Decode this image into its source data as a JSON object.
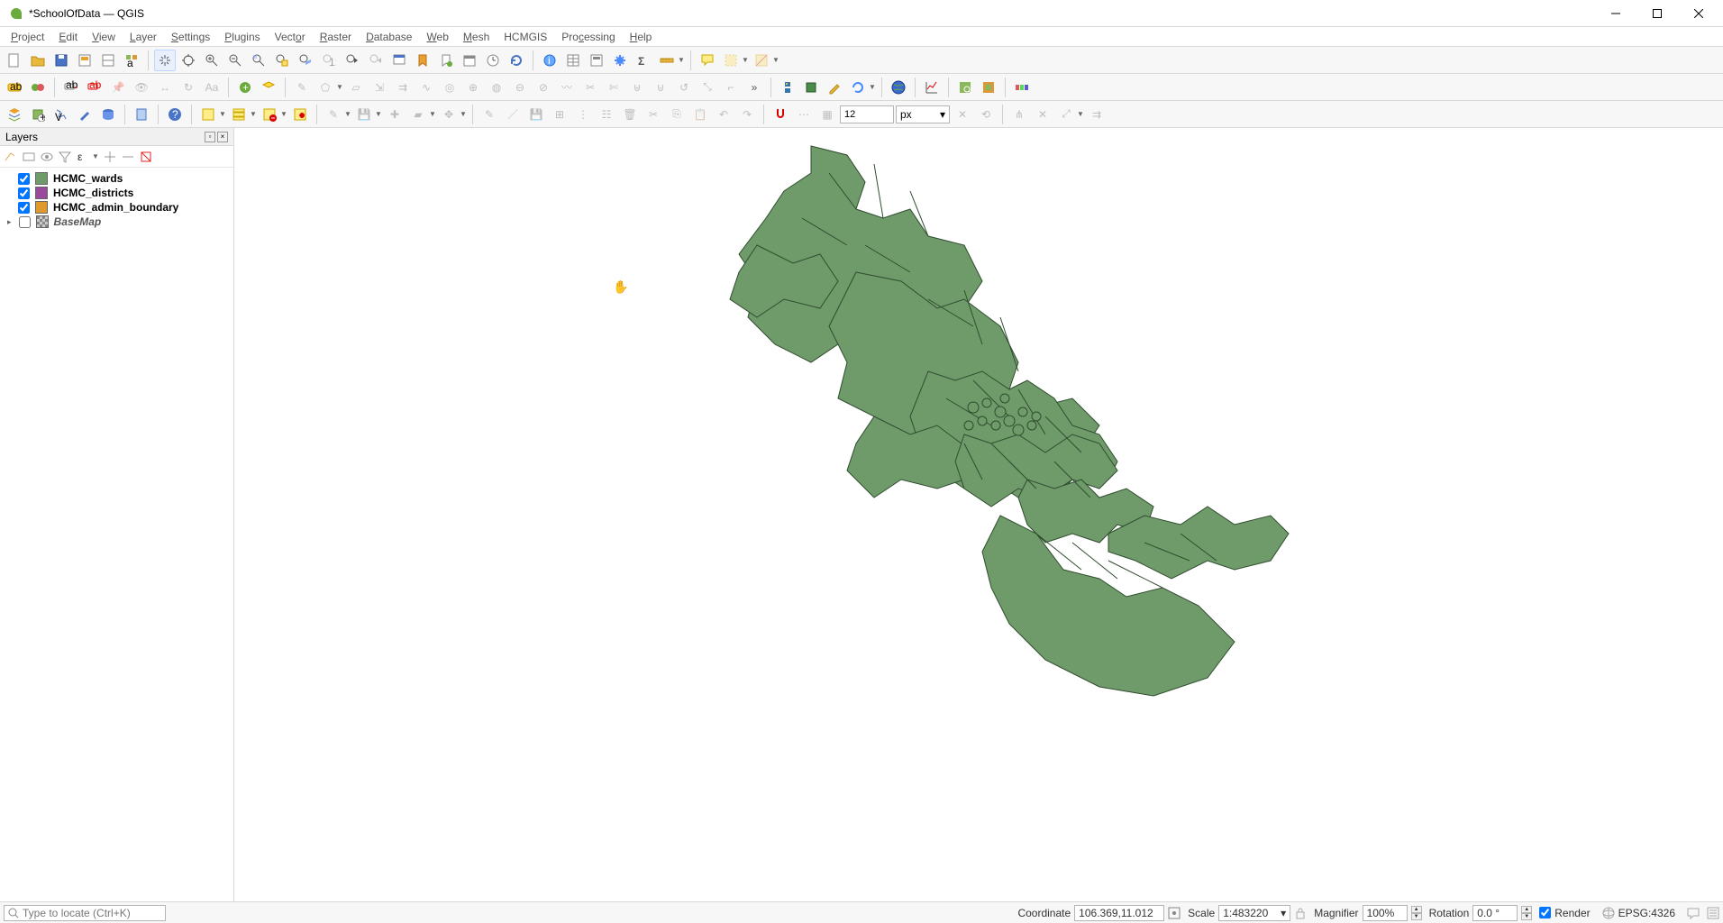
{
  "window": {
    "title": "*SchoolOfData — QGIS"
  },
  "menu": {
    "items": [
      "Project",
      "Edit",
      "View",
      "Layer",
      "Settings",
      "Plugins",
      "Vector",
      "Raster",
      "Database",
      "Web",
      "Mesh",
      "HCMGIS",
      "Processing",
      "Help"
    ]
  },
  "layers_panel": {
    "title": "Layers",
    "items": [
      {
        "name": "HCMC_wards",
        "checked": true,
        "color": "#6f9a6a",
        "bold": true,
        "italic": false
      },
      {
        "name": "HCMC_districts",
        "checked": true,
        "color": "#9a4a9a",
        "bold": true,
        "italic": false
      },
      {
        "name": "HCMC_admin_boundary",
        "checked": true,
        "color": "#de9a2c",
        "bold": true,
        "italic": false
      },
      {
        "name": "BaseMap",
        "checked": false,
        "color": "#888888",
        "bold": true,
        "italic": true,
        "raster": true
      }
    ]
  },
  "toolbar": {
    "spin_value": "12",
    "spin_unit": "px"
  },
  "statusbar": {
    "locator_placeholder": "Type to locate (Ctrl+K)",
    "coord_label": "Coordinate",
    "coord_value": "106.369,11.012",
    "scale_label": "Scale",
    "scale_value": "1:483220",
    "mag_label": "Magnifier",
    "mag_value": "100%",
    "rot_label": "Rotation",
    "rot_value": "0.0 °",
    "render_label": "Render",
    "render_checked": true,
    "crs_label": "EPSG:4326"
  },
  "map": {
    "fill": "#6f9a6a",
    "stroke": "#2f4d2f"
  }
}
